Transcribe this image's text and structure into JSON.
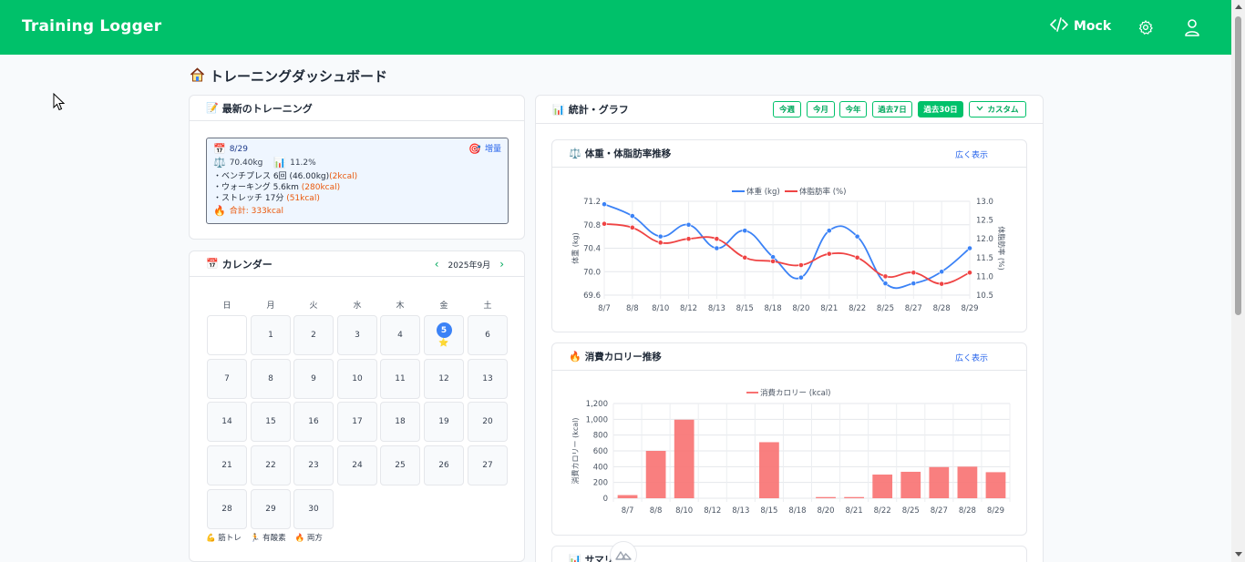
{
  "app": {
    "title": "Training Logger",
    "mock_label": "Mock"
  },
  "page": {
    "title": "トレーニングダッシュボード"
  },
  "latest": {
    "header": "最新のトレーニング",
    "date": "8/29",
    "goal_label": "増量",
    "weight": "70.40kg",
    "bodyfat": "11.2%",
    "items": [
      {
        "text": "・ベンチプレス 6回 (46.00kg)",
        "kcal": "(2kcal)"
      },
      {
        "text": "・ウォーキング 5.6km ",
        "kcal": "(280kcal)"
      },
      {
        "text": "・ストレッチ 17分 ",
        "kcal": "(51kcal)"
      }
    ],
    "total": "合計: 333kcal"
  },
  "calendar": {
    "header": "カレンダー",
    "month": "2025年9月",
    "weekdays": [
      "日",
      "月",
      "火",
      "水",
      "木",
      "金",
      "土"
    ],
    "days": [
      "",
      "1",
      "2",
      "3",
      "4",
      "5",
      "6",
      "7",
      "8",
      "9",
      "10",
      "11",
      "12",
      "13",
      "14",
      "15",
      "16",
      "17",
      "18",
      "19",
      "20",
      "21",
      "22",
      "23",
      "24",
      "25",
      "26",
      "27",
      "28",
      "29",
      "30"
    ],
    "today": "5",
    "legend": [
      "筋トレ",
      "有酸素",
      "両方"
    ]
  },
  "stats": {
    "header": "統計・グラフ",
    "periods": [
      "今週",
      "今月",
      "今年",
      "過去7日",
      "過去30日",
      "カスタム"
    ],
    "active_period": "過去30日"
  },
  "weight_chart": {
    "header": "体重・体脂肪率推移",
    "expand": "広く表示",
    "chart_data": {
      "type": "line",
      "categories": [
        "8/7",
        "8/8",
        "8/10",
        "8/12",
        "8/13",
        "8/15",
        "8/18",
        "8/20",
        "8/21",
        "8/22",
        "8/25",
        "8/27",
        "8/28",
        "8/29"
      ],
      "series": [
        {
          "name": "体重 (kg)",
          "axis": "left",
          "color": "#3b82f6",
          "values": [
            71.15,
            70.95,
            70.6,
            70.8,
            70.4,
            70.7,
            70.25,
            69.9,
            70.7,
            70.6,
            69.8,
            69.8,
            70.0,
            70.4
          ]
        },
        {
          "name": "体脂肪率 (%)",
          "axis": "right",
          "color": "#ef4444",
          "values": [
            12.4,
            12.3,
            11.9,
            12.0,
            12.0,
            11.5,
            11.4,
            11.3,
            11.6,
            11.5,
            11.0,
            11.1,
            10.8,
            11.1
          ]
        }
      ],
      "ylabel": "体重 (kg)",
      "y2label": "体脂肪率 (%)",
      "ylim": [
        69.6,
        71.2
      ],
      "y2lim": [
        10.5,
        13.0
      ],
      "yticks": [
        "71.2",
        "70.8",
        "70.4",
        "70.0",
        "69.6"
      ],
      "y2ticks": [
        "13.0",
        "12.5",
        "12.0",
        "11.5",
        "11.0",
        "10.5"
      ],
      "grid": true,
      "legend": "top"
    }
  },
  "calorie_chart": {
    "header": "消費カロリー推移",
    "expand": "広く表示",
    "chart_data": {
      "type": "bar",
      "categories": [
        "8/7",
        "8/8",
        "8/10",
        "8/12",
        "8/13",
        "8/15",
        "8/18",
        "8/20",
        "8/21",
        "8/22",
        "8/25",
        "8/27",
        "8/28",
        "8/29"
      ],
      "series": [
        {
          "name": "消費カロリー (kcal)",
          "color": "#f87171",
          "values": [
            40,
            600,
            995,
            0,
            0,
            710,
            0,
            15,
            15,
            300,
            335,
            395,
            400,
            330
          ]
        }
      ],
      "ylabel": "消費カロリー (kcal)",
      "ylim": [
        0,
        1200
      ],
      "yticks": [
        "1,200",
        "1,000",
        "800",
        "600",
        "400",
        "200",
        "0"
      ],
      "grid": true,
      "legend": "top"
    }
  },
  "summary": {
    "header": "サマリー"
  }
}
